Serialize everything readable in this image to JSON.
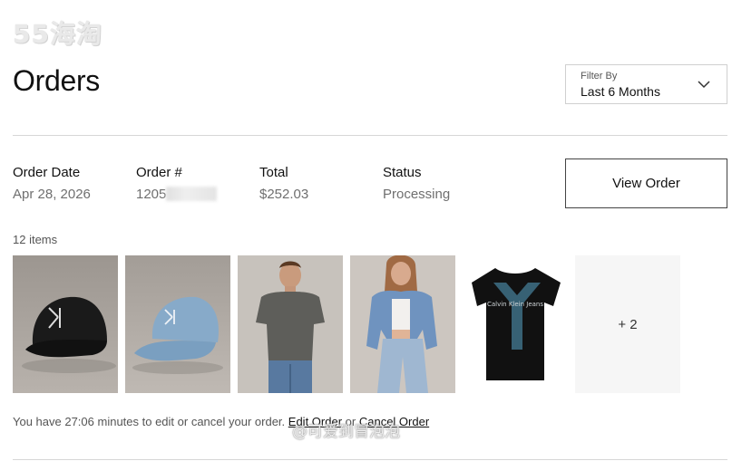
{
  "watermark": {
    "text": "55海淘"
  },
  "page": {
    "title": "Orders"
  },
  "filter": {
    "label": "Filter By",
    "value": "Last 6 Months"
  },
  "order": {
    "columns": [
      {
        "header": "Order Date",
        "value": "Apr 28, 2026"
      },
      {
        "header": "Order #",
        "value": "1205"
      },
      {
        "header": "Total",
        "value": "$252.03"
      },
      {
        "header": "Status",
        "value": "Processing"
      }
    ],
    "view_button": "View Order",
    "items_count": "12 items",
    "thumbnails": [
      {
        "name": "black-ck-cap"
      },
      {
        "name": "light-blue-denim-cap"
      },
      {
        "name": "grey-tshirt-model"
      },
      {
        "name": "denim-jacket-model"
      },
      {
        "name": "black-ck-tshirt",
        "print": "Calvin Klein Jeans"
      }
    ],
    "more_label": "+ 2",
    "notice": {
      "text": "You have 27:06 minutes to edit or cancel your order.",
      "edit_link": "Edit Order",
      "or": "or",
      "cancel_link": "Cancel Order"
    }
  },
  "credit": {
    "text": "@可爱到冒泡泡"
  },
  "colors": {
    "border": "#d0d0d0",
    "muted_text": "#6f6f6f",
    "placeholder_bg": "#f6f6f6"
  }
}
